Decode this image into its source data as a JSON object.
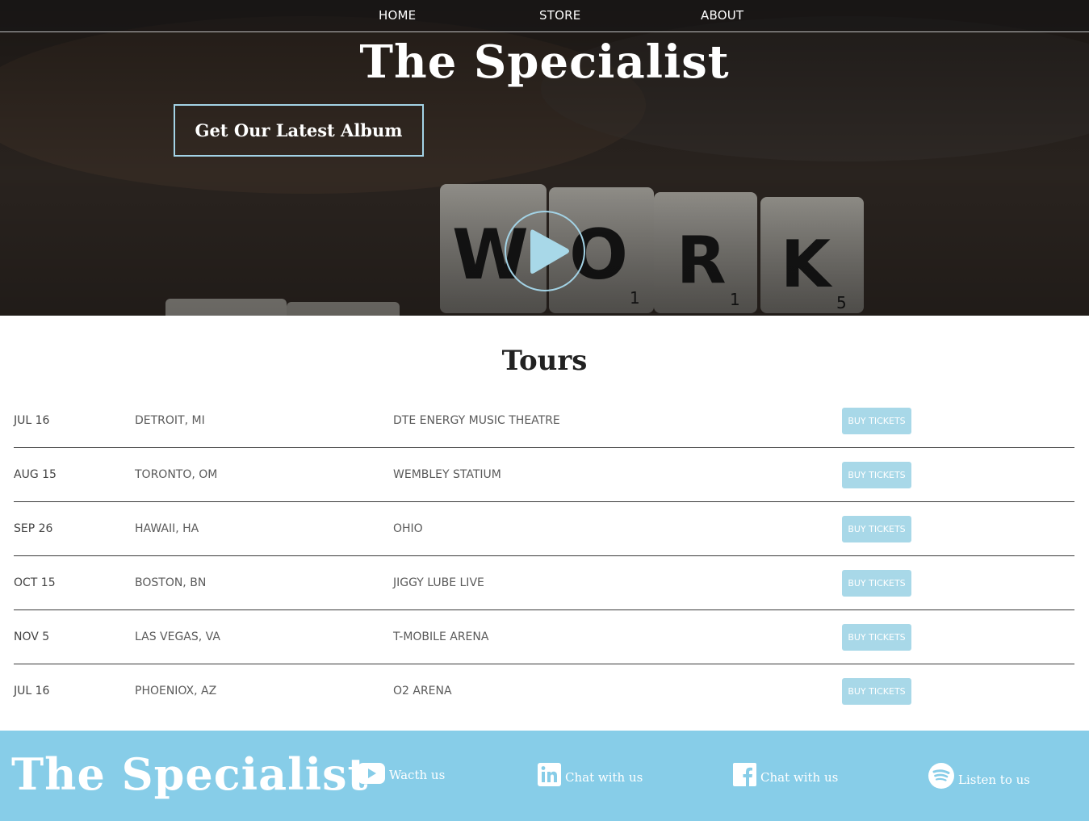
{
  "nav": {
    "home": "HOME",
    "store": "STORE",
    "about": "ABOUT"
  },
  "hero": {
    "title": "The Specialist",
    "album_button": "Get Our Latest Album",
    "tiles": [
      "W",
      "O",
      "R",
      "K"
    ],
    "tile_scores": [
      "",
      "1",
      "1",
      "5"
    ]
  },
  "tours": {
    "title": "Tours",
    "rows": [
      {
        "date": "JUL 16",
        "city": "DETROIT, MI",
        "venue": "DTE ENERGY MUSIC THEATRE",
        "button": "BUY TICKETS"
      },
      {
        "date": "AUG 15",
        "city": "TORONTO, OM",
        "venue": "WEMBLEY STATIUM",
        "button": "BUY TICKETS"
      },
      {
        "date": "SEP 26",
        "city": "HAWAII, HA",
        "venue": "OHIO",
        "button": "BUY TICKETS"
      },
      {
        "date": "OCT 15",
        "city": "BOSTON, BN",
        "venue": "JIGGY LUBE LIVE",
        "button": "BUY TICKETS"
      },
      {
        "date": "NOV 5",
        "city": "LAS VEGAS, VA",
        "venue": "T-MOBILE ARENA",
        "button": "BUY TICKETS"
      },
      {
        "date": "JUL 16",
        "city": "PHOENIOX, AZ",
        "venue": "O2 ARENA",
        "button": "BUY TICKETS"
      }
    ]
  },
  "footer": {
    "title": "The Specialist",
    "links": {
      "youtube": "Wacth us",
      "linkedin": "Chat with us",
      "facebook": "Chat with us",
      "spotify": "Listen to us"
    }
  },
  "colors": {
    "accent": "#87cde8",
    "button": "#a8d8e8",
    "outline": "#a3d3e6"
  },
  "icons": {
    "play": "play-icon",
    "youtube": "youtube-icon",
    "linkedin": "linkedin-icon",
    "facebook": "facebook-icon",
    "spotify": "spotify-icon"
  }
}
